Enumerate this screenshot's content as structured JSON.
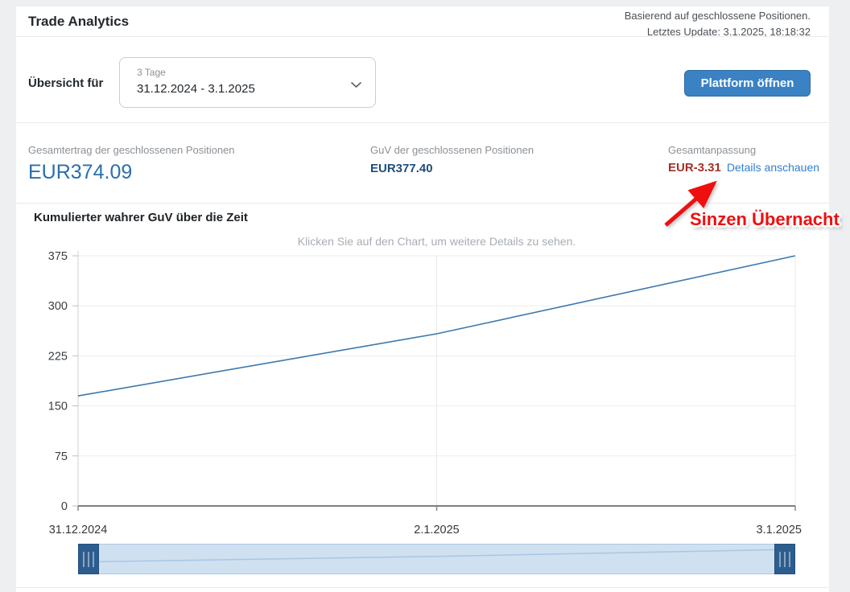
{
  "header": {
    "title": "Trade Analytics",
    "note_line1": "Basierend auf geschlossene Positionen.",
    "note_line2": "Letztes Update: 3.1.2025, 18:18:32"
  },
  "overview": {
    "label": "Übersicht für",
    "range_caption": "3 Tage",
    "range_value": "31.12.2024 - 3.1.2025",
    "open_platform_label": "Plattform öffnen"
  },
  "stats": [
    {
      "label": "Gesamtertrag der geschlossenen Positionen",
      "value": "EUR374.09"
    },
    {
      "label": "GuV der geschlossenen Positionen",
      "value": "EUR377.40"
    },
    {
      "label": "Gesamtanpassung",
      "value": "EUR-3.31",
      "link": "Details anschauen"
    }
  ],
  "annotation": {
    "text": "Sinzen Übernacht"
  },
  "chart": {
    "title": "Kumulierter wahrer GuV über die Zeit",
    "hint": "Klicken Sie auf den Chart, um weitere Details zu sehen."
  },
  "chart_data": {
    "type": "line",
    "x": [
      "31.12.2024",
      "2.1.2025",
      "3.1.2025"
    ],
    "values": [
      165,
      258,
      375
    ],
    "title": "Kumulierter wahrer GuV über die Zeit",
    "xlabel": "",
    "ylabel": "",
    "ylim": [
      0,
      375
    ],
    "yticks": [
      0,
      75,
      150,
      225,
      300,
      375
    ],
    "grid": true,
    "legend": "none",
    "line_color": "#3c78ad"
  },
  "colors": {
    "accent_blue": "#3a82c4",
    "value_blue": "#2a6fad",
    "value_navy": "#1d4e79",
    "negative_red": "#a33026",
    "link_blue": "#2f7fd3",
    "annotation_red": "#ee1010",
    "slider_track": "#cfe0f0",
    "slider_handle": "#2d5d8e"
  }
}
